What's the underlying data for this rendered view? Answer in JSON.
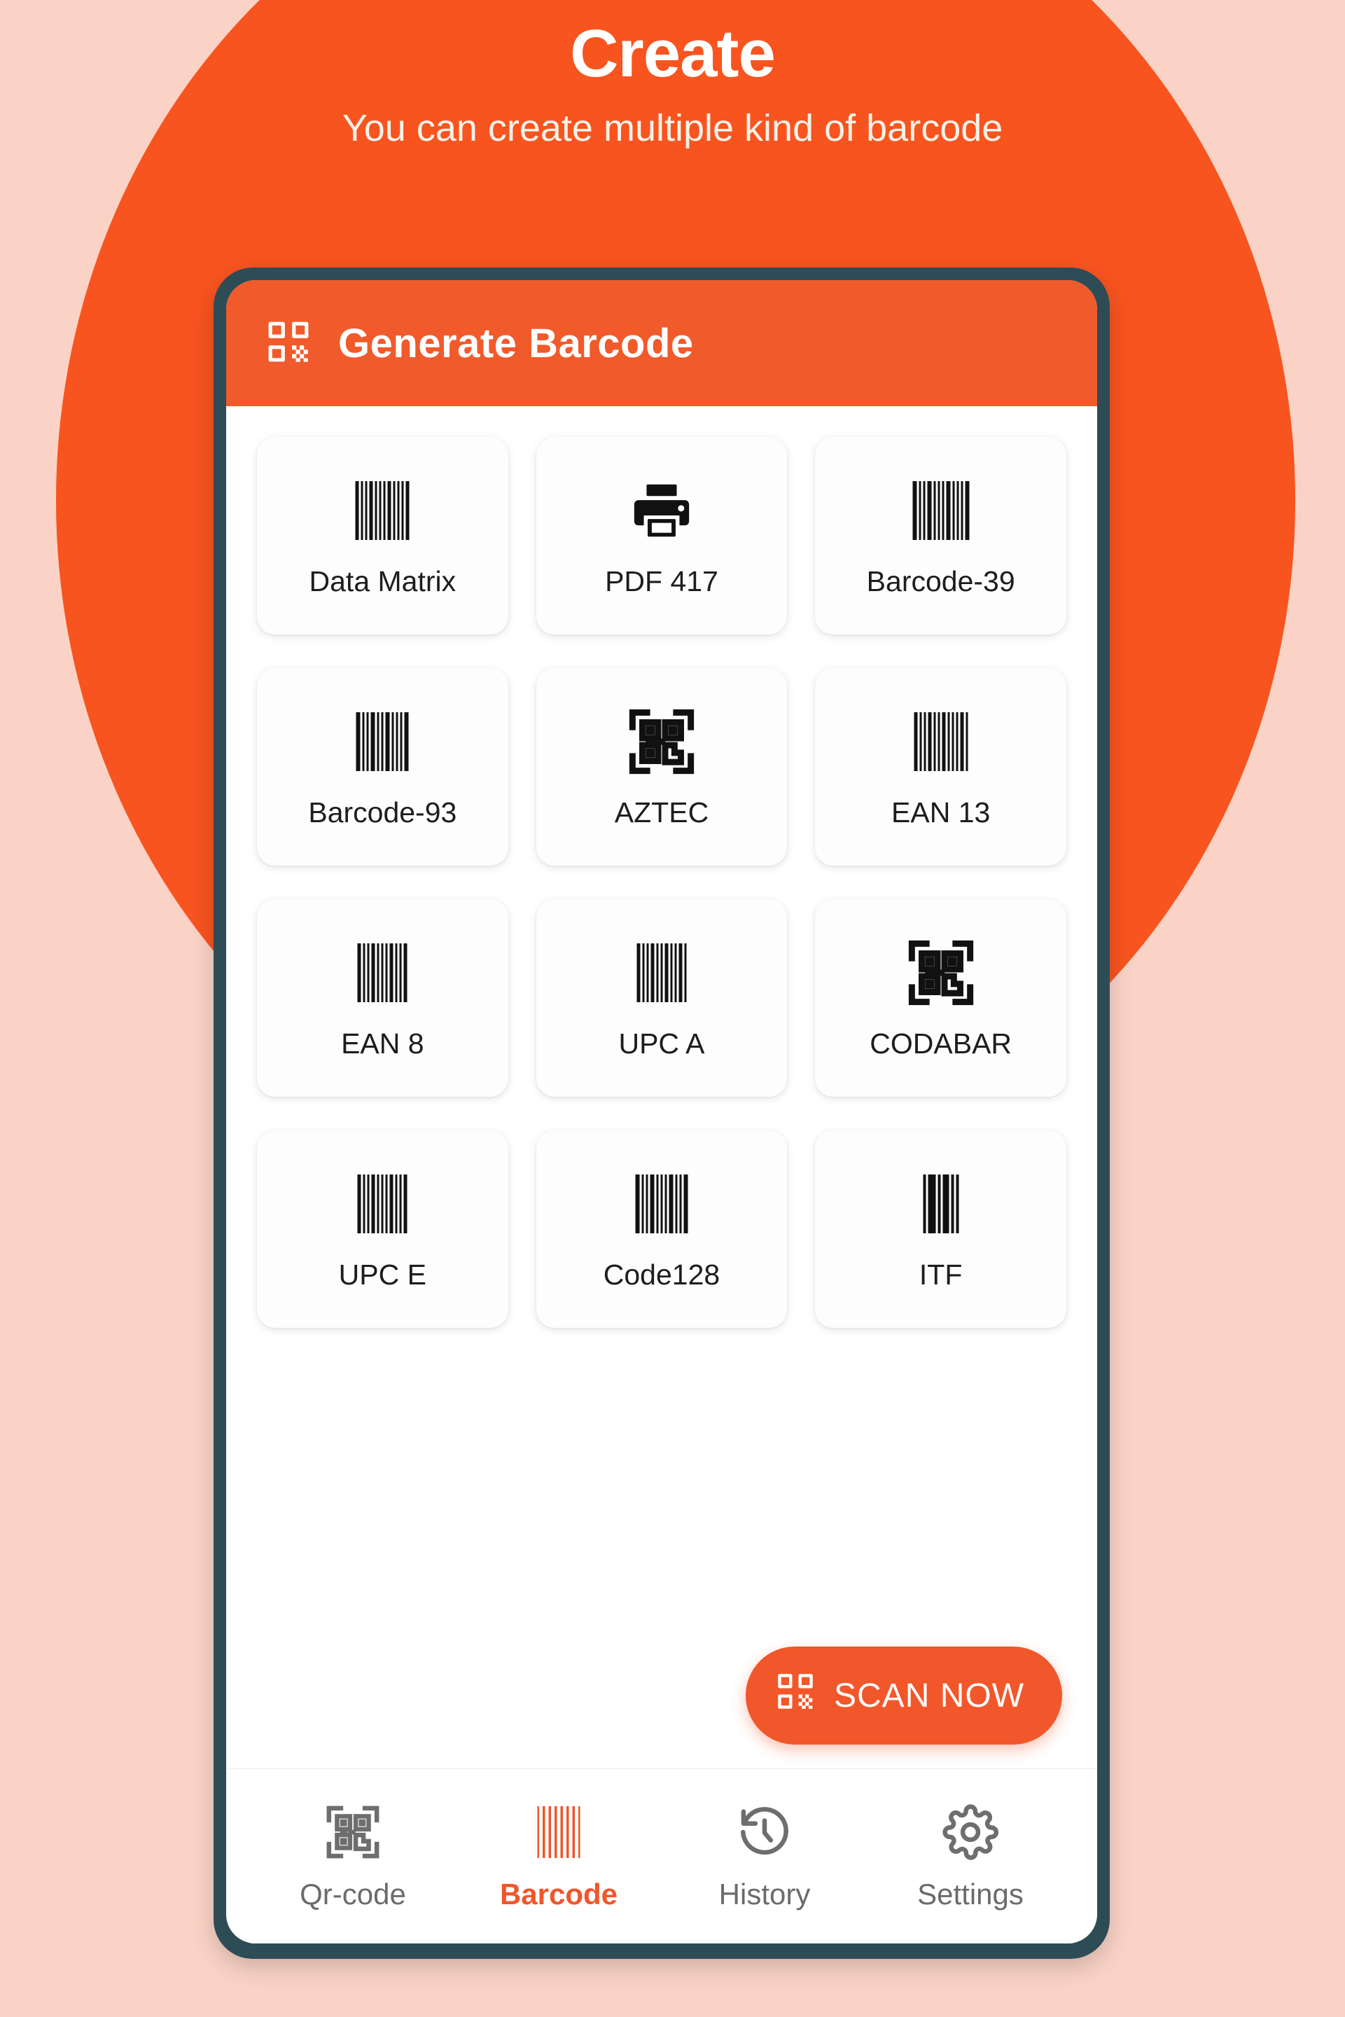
{
  "promo": {
    "title": "Create",
    "subtitle": "You can create multiple kind of barcode"
  },
  "colors": {
    "background": "#fbd3c6",
    "blob": "#f8541f",
    "accent": "#f1572b",
    "phone_frame": "#2e4c55",
    "appbar": "#f15a2b",
    "screen": "#ffffff",
    "label_text": "#1d1d1d",
    "nav_inactive": "#6b6b6b",
    "nav_active": "#f0562b"
  },
  "appbar": {
    "icon": "qr-code-icon",
    "title": "Generate Barcode"
  },
  "grid": {
    "items": [
      {
        "label": "Data Matrix",
        "icon": "barcode-lines-icon"
      },
      {
        "label": "PDF 417",
        "icon": "printer-icon"
      },
      {
        "label": "Barcode-39",
        "icon": "barcode-lines-icon"
      },
      {
        "label": "Barcode-93",
        "icon": "barcode-lines-icon"
      },
      {
        "label": "AZTEC",
        "icon": "qr-scan-icon"
      },
      {
        "label": "EAN 13",
        "icon": "barcode-lines-icon"
      },
      {
        "label": "EAN 8",
        "icon": "barcode-lines-icon"
      },
      {
        "label": "UPC A",
        "icon": "barcode-lines-icon"
      },
      {
        "label": "CODABAR",
        "icon": "qr-scan-icon"
      },
      {
        "label": "UPC E",
        "icon": "barcode-lines-icon"
      },
      {
        "label": "Code128",
        "icon": "barcode-lines-icon"
      },
      {
        "label": "ITF",
        "icon": "barcode-wide-lines-icon"
      }
    ]
  },
  "scan_button": {
    "label": "SCAN NOW",
    "icon": "qr-code-icon"
  },
  "bottom_nav": {
    "active": "Barcode",
    "items": [
      {
        "label": "Qr-code",
        "icon": "qr-scan-icon",
        "active": false
      },
      {
        "label": "Barcode",
        "icon": "barcode-icon",
        "active": true
      },
      {
        "label": "History",
        "icon": "clock-back-icon",
        "active": false
      },
      {
        "label": "Settings",
        "icon": "gear-icon",
        "active": false
      }
    ]
  }
}
